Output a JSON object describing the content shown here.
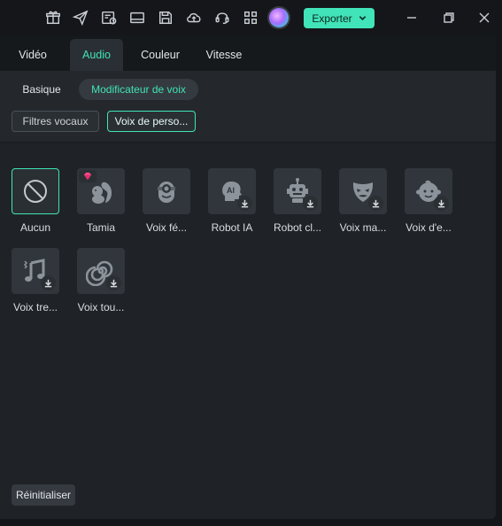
{
  "toolbar": {
    "icons": [
      "gift-icon",
      "send-icon",
      "schedule-icon",
      "layout-icon",
      "save-icon",
      "cloud-upload-icon",
      "headset-icon",
      "grid-icon"
    ],
    "export_label": "Exporter"
  },
  "tabs": [
    "Vidéo",
    "Audio",
    "Couleur",
    "Vitesse"
  ],
  "active_tab": "Audio",
  "subtabs": [
    "Basique",
    "Modificateur de voix"
  ],
  "active_subtab": "Modificateur de voix",
  "filters": [
    "Filtres vocaux",
    "Voix de perso..."
  ],
  "active_filter": "Voix de perso...",
  "voices": [
    {
      "label": "Aucun",
      "icon": "none-icon",
      "selected": true
    },
    {
      "label": "Tamia",
      "icon": "squirrel-icon",
      "premium": true
    },
    {
      "label": "Voix fé...",
      "icon": "minion-icon",
      "download": false
    },
    {
      "label": "Robot IA",
      "icon": "ai-head-icon",
      "download": true
    },
    {
      "label": "Robot cl...",
      "icon": "robot-icon",
      "download": true
    },
    {
      "label": "Voix ma...",
      "icon": "mask-icon",
      "download": true
    },
    {
      "label": "Voix d'e...",
      "icon": "baby-face-icon",
      "download": true
    },
    {
      "label": "Voix tre...",
      "icon": "music-note-icon",
      "download": true
    },
    {
      "label": "Voix tou...",
      "icon": "spiral-icon",
      "download": true
    }
  ],
  "reset_label": "Réinitialiser",
  "colors": {
    "accent": "#41e3b8",
    "panel": "#1f2328",
    "tile": "#31363c"
  }
}
